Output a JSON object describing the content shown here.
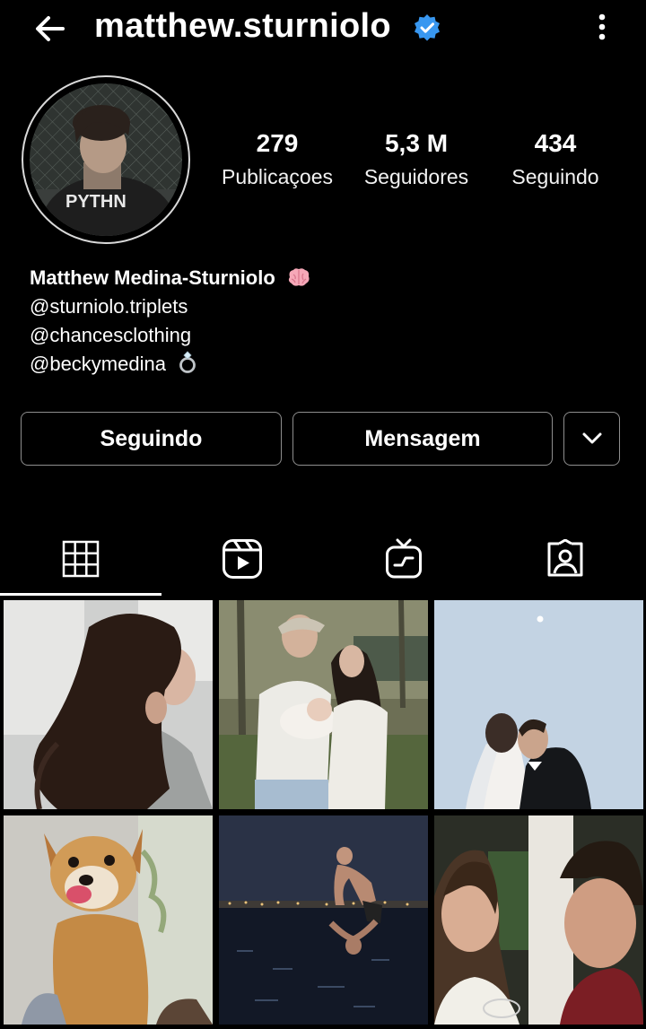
{
  "header": {
    "username": "matthew.sturniolo",
    "back_icon": "arrow-left-icon",
    "verified_icon": "verified-badge-icon",
    "more_icon": "more-vertical-icon"
  },
  "profile": {
    "stats": [
      {
        "value": "279",
        "label": "Publicaçoes"
      },
      {
        "value": "5,3 M",
        "label": "Seguidores"
      },
      {
        "value": "434",
        "label": "Seguindo"
      }
    ],
    "avatar_text": "PYTHN"
  },
  "bio": {
    "name": "Matthew Medina-Sturniolo",
    "lines": [
      "@sturniolo.triplets",
      "@chancesclothing",
      "@beckymedina"
    ]
  },
  "actions": {
    "following_label": "Seguindo",
    "message_label": "Mensagem",
    "dropdown_icon": "chevron-down-icon"
  },
  "tabs": [
    "grid-icon",
    "reels-icon",
    "igtv-icon",
    "tagged-icon"
  ],
  "colors": {
    "background": "#000000",
    "verified": "#3897f0",
    "button_border": "#8e8e8e"
  }
}
